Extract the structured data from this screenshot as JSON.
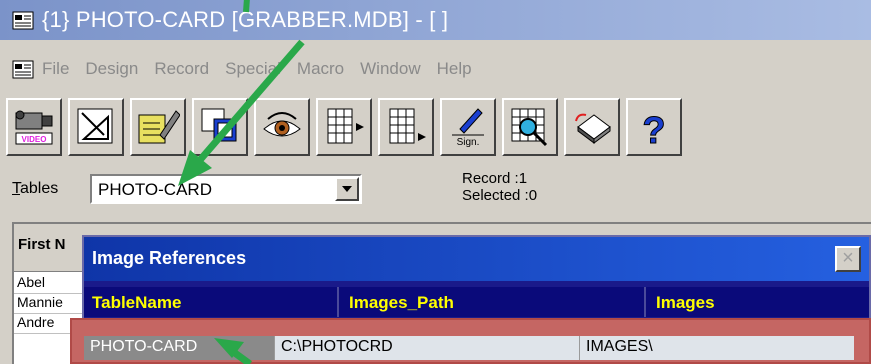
{
  "window": {
    "title": "{1} PHOTO-CARD [GRABBER.MDB] - [ ]"
  },
  "menu": [
    "File",
    "Design",
    "Record",
    "Special",
    "Macro",
    "Window",
    "Help"
  ],
  "toolbar": {
    "video_label": "VIDEO",
    "sign_label": "Sign."
  },
  "tables": {
    "label_prefix": "T",
    "label_rest": "ables",
    "selected": "PHOTO-CARD",
    "record_line": "Record  :1",
    "selected_line": "Selected :0"
  },
  "grid": {
    "header": "First N",
    "rows": [
      "Abel",
      "Mannie",
      "Andre"
    ]
  },
  "dialog": {
    "title": "Image References",
    "close_glyph": "×",
    "columns": [
      "TableName",
      "Images_Path",
      "Images"
    ],
    "row": {
      "TableName": "PHOTO-CARD",
      "Images_Path": "C:\\PHOTOCRD",
      "Images": "IMAGES\\"
    }
  },
  "colors": {
    "arrow": "#2aa84a",
    "highlight": "#c56663",
    "header_text": "#ffff00"
  },
  "icons": [
    "video-camera-icon",
    "design-icon",
    "edit-icon",
    "form-icon",
    "eye-icon",
    "grid-insert-icon",
    "grid-append-icon",
    "sign-icon",
    "grid-zoom-icon",
    "eraser-icon",
    "help-icon"
  ]
}
